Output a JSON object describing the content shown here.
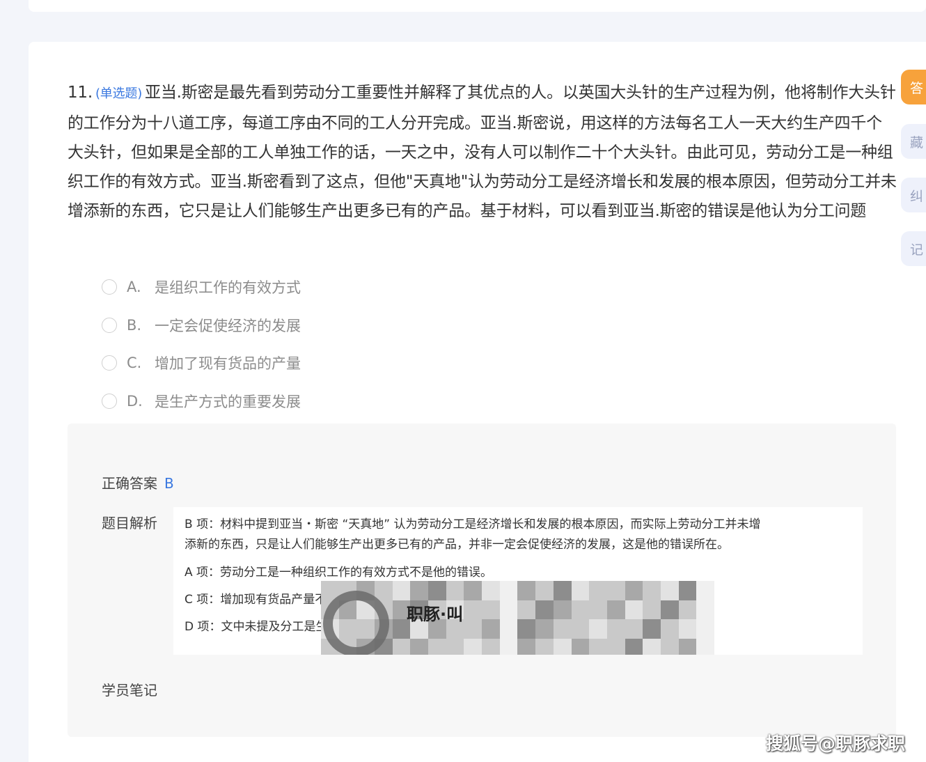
{
  "question": {
    "number": "11.",
    "type": "(单选题)",
    "text": "亚当.斯密是最先看到劳动分工重要性并解释了其优点的人。以英国大头针的生产过程为例，他将制作大头针的工作分为十八道工序，每道工序由不同的工人分开完成。亚当.斯密说，用这样的方法每名工人一天大约生产四千个大头针，但如果是全部的工人单独工作的话，一天之中，没有人可以制作二十个大头针。由此可见，劳动分工是一种组织工作的有效方式。亚当.斯密看到了这点，但他\"天真地\"认为劳动分工是经济增长和发展的根本原因，但劳动分工并未增添新的东西，它只是让人们能够生产出更多已有的产品。基于材料，可以看到亚当.斯密的错误是他认为分工问题"
  },
  "options": [
    {
      "letter": "A.",
      "text": "是组织工作的有效方式"
    },
    {
      "letter": "B.",
      "text": "一定会促使经济的发展"
    },
    {
      "letter": "C.",
      "text": "增加了现有货品的产量"
    },
    {
      "letter": "D.",
      "text": "是生产方式的重要发展"
    }
  ],
  "answer": {
    "correct_label": "正确答案",
    "correct_value": "B",
    "analysis_label": "题目解析",
    "notes_label": "学员笔记",
    "analysis_lines": [
      "B 项：材料中提到亚当・斯密 “天真地” 认为劳动分工是经济增长和发展的根本原因，而实际上劳动分工并未增",
      "添新的东西，只是让人们能够生产出更多已有的产品，并非一定会促使经济的发展，这是他的错误所在。",
      "A 项：劳动分工是一种组织工作的有效方式不是他的错误。",
      "C 项：增加现有货品产量不是错误。",
      "D 项：文中未提及分工是生"
    ],
    "logo_text": "职豚·叫"
  },
  "side_tabs": [
    "答",
    "藏",
    "纠",
    "记"
  ],
  "watermark": "搜狐号@职豚求职",
  "colors": {
    "accent": "#3a78e0",
    "active_tab": "#f7a23b",
    "background": "#f3f5fa"
  }
}
